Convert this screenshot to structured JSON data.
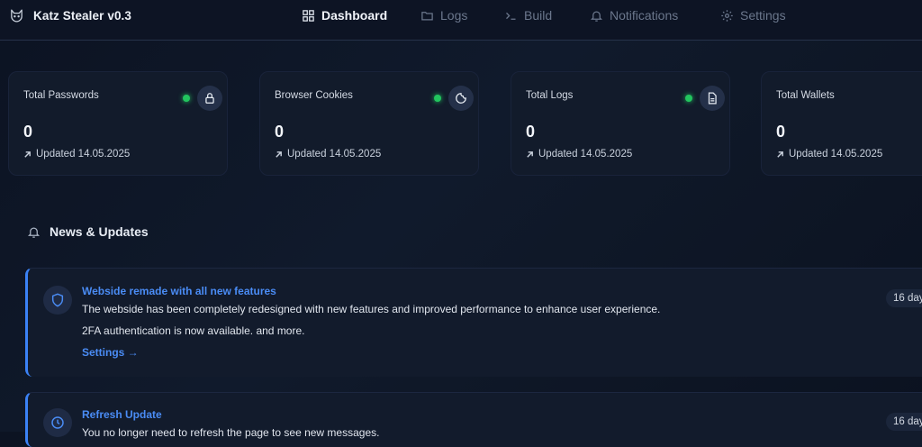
{
  "app": {
    "title": "Katz Stealer v0.3",
    "icon": "cat-icon"
  },
  "nav": [
    {
      "label": "Dashboard",
      "icon": "grid-icon",
      "active": true
    },
    {
      "label": "Logs",
      "icon": "folder-icon",
      "active": false
    },
    {
      "label": "Build",
      "icon": "terminal-icon",
      "active": false
    },
    {
      "label": "Notifications",
      "icon": "bell-icon",
      "active": false
    },
    {
      "label": "Settings",
      "icon": "gear-icon",
      "active": false
    }
  ],
  "stats": [
    {
      "title": "Total Passwords",
      "value": "0",
      "updated": "Updated 14.05.2025",
      "icon": "lock-icon",
      "status": "online"
    },
    {
      "title": "Browser Cookies",
      "value": "0",
      "updated": "Updated 14.05.2025",
      "icon": "cookie-icon",
      "status": "online"
    },
    {
      "title": "Total Logs",
      "value": "0",
      "updated": "Updated 14.05.2025",
      "icon": "file-icon",
      "status": "online"
    },
    {
      "title": "Total Wallets",
      "value": "0",
      "updated": "Updated 14.05.2025",
      "icon": "wallet-icon",
      "status": "online"
    }
  ],
  "news": {
    "title": "News & Updates",
    "icon": "bell-icon",
    "items": [
      {
        "title": "Webside remade with all new features",
        "icon": "shield-icon",
        "lines": [
          "The webside has been completely redesigned with new features and improved performance to enhance user experience.",
          "2FA authentication is now available. and more."
        ],
        "link": "Settings →",
        "time": "16 day"
      },
      {
        "title": "Refresh Update",
        "icon": "clock-icon",
        "lines": [
          "You no longer need to refresh the page to see new messages."
        ],
        "time": "16 day"
      }
    ]
  },
  "colors": {
    "background": "#0c1322",
    "card": "#121b2b",
    "accent": "#3b82f6",
    "status_online": "#22c55e"
  }
}
